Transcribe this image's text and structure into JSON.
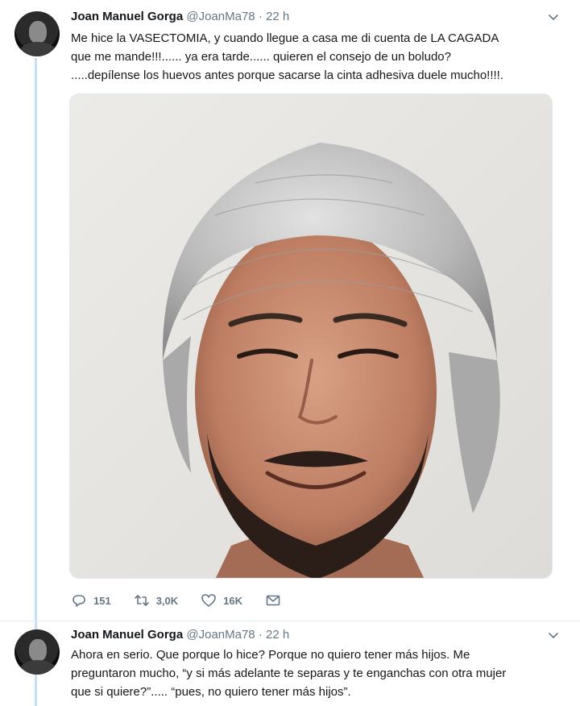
{
  "tweets": [
    {
      "author_name": "Joan Manuel Gorga",
      "handle": "@JoanMa78",
      "separator": "·",
      "time": "22 h",
      "lines": [
        "Me hice la VASECTOMIA, y cuando llegue a casa me di cuenta de LA CAGADA",
        "que me mande!!!...... ya era tarde...... quieren el consejo de un boludo?",
        ".....depílense los huevos antes porque sacarse la cinta adhesiva duele mucho!!!!."
      ],
      "actions": {
        "reply_count": "151",
        "retweet_count": "3,0K",
        "like_count": "16K"
      }
    },
    {
      "author_name": "Joan Manuel Gorga",
      "handle": "@JoanMa78",
      "separator": "·",
      "time": "22 h",
      "lines": [
        "Ahora en serio. Que porque lo hice? Porque no quiero tener más hijos. Me",
        "preguntaron mucho, “y si más adelante te separas y te enganchas con otra mujer",
        "que si quiere?”..... “pues, no quiero tener más hijos”."
      ]
    }
  ],
  "icons": {
    "caret": "chevron-down-icon",
    "reply": "reply-icon",
    "retweet": "retweet-icon",
    "like": "heart-icon",
    "dm": "envelope-icon"
  },
  "colors": {
    "thread_line": "#c4dff6",
    "secondary_text": "#657786",
    "primary_text": "#14171a"
  }
}
